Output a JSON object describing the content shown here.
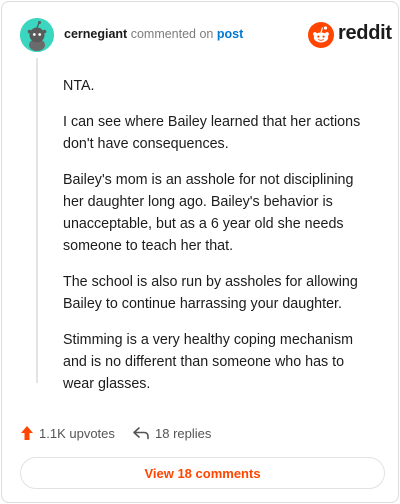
{
  "comment": {
    "username": "cernegiant",
    "action": "commented on",
    "post_link": "post",
    "paragraphs": [
      "NTA.",
      "I can see where Bailey learned that her actions don't have consequences.",
      "Bailey's mom is an asshole for not disciplining her daughter long ago. Bailey's behavior is unacceptable, but as a 6 year old she needs someone to teach her that.",
      "The school is also run by assholes for allowing Bailey to continue harrassing your daughter.",
      "Stimming is a very healthy coping mechanism and is no different than someone who has to wear glasses."
    ]
  },
  "brand": {
    "name": "reddit",
    "icon": "reddit-logo-icon",
    "color": "#ff4500"
  },
  "avatar": {
    "icon": "snoo-avatar-icon",
    "color": "#3ad6c0"
  },
  "stats": {
    "upvotes": "1.1K upvotes",
    "upvote_icon": "upvote-arrow-icon",
    "replies": "18 replies",
    "reply_icon": "reply-arrow-icon"
  },
  "footer": {
    "view_comments": "View 18 comments"
  }
}
